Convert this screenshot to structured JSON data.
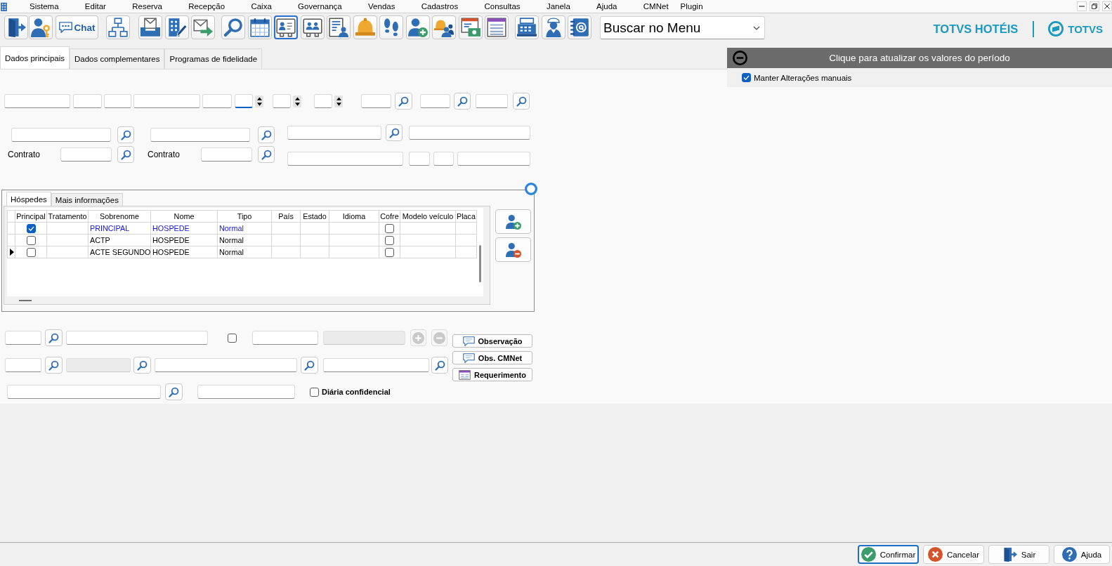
{
  "menu_bar": {
    "items": [
      "Sistema",
      "Editar",
      "Reserva",
      "Recepção",
      "Caixa",
      "Governança",
      "Vendas",
      "Cadastros",
      "Consultas",
      "Janela",
      "Ajuda",
      "CMNet",
      "Plugin"
    ]
  },
  "toolbar": {
    "buttons": [
      {
        "selected": false
      },
      {
        "selected": false
      },
      {
        "label": "Chat",
        "selected": false
      },
      {
        "selected": false
      },
      {
        "selected": false
      },
      {
        "selected": false
      },
      {
        "selected": false
      },
      {
        "selected": false
      },
      {
        "selected": false
      },
      {
        "selected": true
      },
      {
        "selected": false
      },
      {
        "selected": false
      },
      {
        "selected": false
      },
      {
        "selected": false
      },
      {
        "selected": false
      },
      {
        "selected": false
      },
      {
        "selected": false
      },
      {
        "selected": false
      },
      {
        "selected": false
      },
      {
        "selected": false
      },
      {
        "selected": false
      }
    ]
  },
  "menu_search": {
    "value": "Buscar no Menu"
  },
  "brand": {
    "product": "TOTVS HOTÉIS",
    "logo": "TOTVS"
  },
  "tabs": [
    {
      "label": "Dados principais",
      "selected": true
    },
    {
      "label": "Dados complementares",
      "selected": false
    },
    {
      "label": "Programas de fidelidade",
      "selected": false
    }
  ],
  "form": {
    "row_1": [
      {
        "kind": "field"
      },
      {
        "kind": "field"
      },
      {
        "kind": "field"
      },
      {
        "kind": "field"
      },
      {
        "kind": "field"
      },
      {
        "kind": "spin",
        "focused": true
      },
      {
        "kind": "spin",
        "focused": false
      },
      {
        "kind": "spin",
        "focused": false
      },
      {
        "kind": "field"
      },
      {
        "kind": "search"
      },
      {
        "kind": "field"
      },
      {
        "kind": "search"
      },
      {
        "kind": "field"
      },
      {
        "kind": "search"
      }
    ],
    "rows_left": [
      [
        {
          "kind": "field"
        },
        {
          "kind": "search"
        },
        {
          "kind": "field"
        },
        {
          "kind": "search"
        }
      ],
      [
        {
          "kind": "label",
          "text": "Contrato"
        },
        {
          "kind": "field"
        },
        {
          "kind": "search"
        },
        {
          "kind": "label",
          "text": "Contrato"
        },
        {
          "kind": "field"
        },
        {
          "kind": "search"
        }
      ]
    ],
    "rows_right": [
      [
        {
          "kind": "field"
        },
        {
          "kind": "search"
        },
        {
          "kind": "field"
        }
      ],
      [
        {
          "kind": "field"
        },
        {
          "kind": "field"
        },
        {
          "kind": "field"
        },
        {
          "kind": "field"
        }
      ]
    ]
  },
  "guests": {
    "tabs": [
      {
        "label": "Hóspedes",
        "selected": true
      },
      {
        "label": "Mais informações",
        "selected": false
      }
    ],
    "columns": [
      "Principal",
      "Tratamento",
      "Sobrenome",
      "Nome",
      "Tipo",
      "País",
      "Estado",
      "Idioma",
      "Cofre",
      "Modelo veículo",
      "Placa"
    ],
    "rows": [
      {
        "selected": false,
        "principal": true,
        "surname": "PRINCIPAL",
        "name": "HOSPEDE",
        "type": "Normal",
        "safe": false
      },
      {
        "selected": false,
        "principal": false,
        "surname": "ACTP",
        "name": "HOSPEDE",
        "type": "Normal",
        "safe": false
      },
      {
        "selected": true,
        "principal": false,
        "surname": "ACTE SEGUNDO",
        "name": "HOSPEDE",
        "type": "Normal",
        "safe": false
      }
    ]
  },
  "details": {
    "rows": [
      [
        {
          "kind": "field",
          "disabled": false
        },
        {
          "kind": "search"
        },
        {
          "kind": "field",
          "disabled": false
        },
        {
          "kind": "checkbox",
          "checked": false
        },
        {
          "kind": "field",
          "disabled": false
        },
        {
          "kind": "field",
          "disabled": true
        },
        {
          "kind": "add",
          "disabled": true
        },
        {
          "kind": "remove",
          "disabled": true
        }
      ],
      [
        {
          "kind": "field",
          "disabled": false
        },
        {
          "kind": "search"
        },
        {
          "kind": "field",
          "disabled": true
        },
        {
          "kind": "search"
        },
        {
          "kind": "field",
          "disabled": false
        },
        {
          "kind": "search"
        },
        {
          "kind": "field",
          "disabled": false
        },
        {
          "kind": "search"
        }
      ],
      [
        {
          "kind": "field",
          "disabled": false
        },
        {
          "kind": "search"
        },
        {
          "kind": "field",
          "disabled": false
        },
        {
          "kind": "checkbox",
          "checked": false,
          "label": "Diária confidencial"
        }
      ]
    ],
    "note_buttons": [
      "Observação",
      "Obs. CMNet",
      "Requerimento"
    ]
  },
  "period_panel": {
    "title": "Clique para atualizar os valores do período",
    "expanded": true,
    "keep_manual": {
      "label": "Manter Alterações manuais",
      "checked": true
    }
  },
  "footer": {
    "buttons": [
      {
        "label": "Confirmar",
        "focused": true
      },
      {
        "label": "Cancelar",
        "focused": false
      },
      {
        "label": "Sair",
        "focused": false
      },
      {
        "label": "Ajuda",
        "focused": false
      }
    ]
  }
}
